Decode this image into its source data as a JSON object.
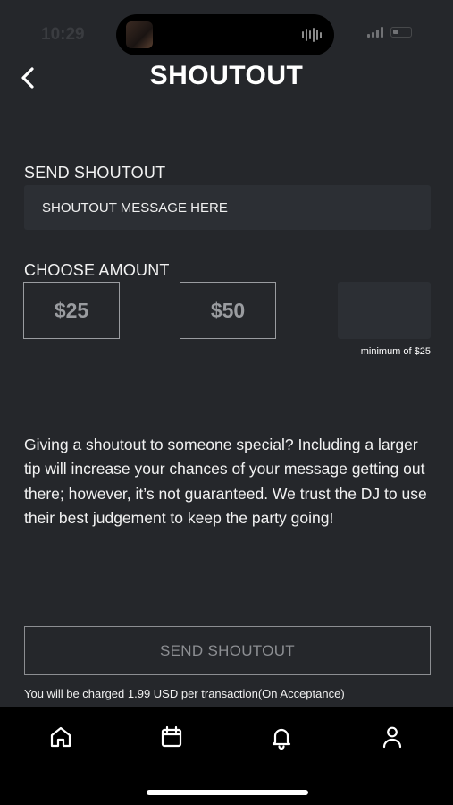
{
  "status_bar": {
    "time": "10:29"
  },
  "header": {
    "title": "SHOUTOUT"
  },
  "shoutout": {
    "section_label": "SEND SHOUTOUT",
    "message_placeholder": "SHOUTOUT MESSAGE HERE"
  },
  "amount": {
    "section_label": "CHOOSE AMOUNT",
    "options": [
      "$25",
      "$50"
    ],
    "custom_value": "",
    "minimum_note": "minimum of $25"
  },
  "description": "Giving a shoutout to someone special? Including a larger tip will increase your chances of your message getting out there; however, it’s not guaranteed. We trust the DJ to use their best judgement to keep the party going!",
  "actions": {
    "send_label": "SEND SHOUTOUT",
    "charge_note": "You will be charged 1.99 USD per transaction(On Acceptance)"
  },
  "tab_bar": {
    "tabs": [
      {
        "name": "home",
        "icon": "home-icon"
      },
      {
        "name": "calendar",
        "icon": "calendar-icon"
      },
      {
        "name": "notifications",
        "icon": "bell-icon"
      },
      {
        "name": "profile",
        "icon": "user-icon"
      }
    ]
  },
  "colors": {
    "background": "#25272b",
    "field": "#2c2f34",
    "muted_border": "#9a9ca0",
    "tab_bar": "#000000"
  }
}
